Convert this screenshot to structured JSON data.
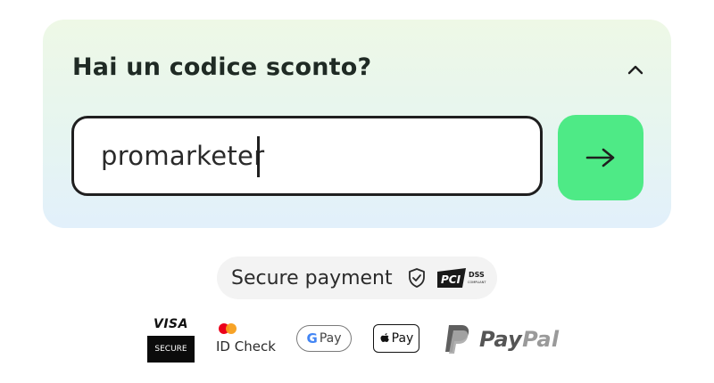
{
  "promo": {
    "title": "Hai un codice sconto?",
    "code_value": "promarketer",
    "toggle_icon": "chevron-up-icon",
    "apply_icon": "arrow-right-icon",
    "apply_color": "#4eea86"
  },
  "secure": {
    "label": "Secure payment",
    "shield_icon": "shield-check-icon",
    "pci_text": "PCI",
    "dss_text": "DSS",
    "compliant_text": "COMPLIANT"
  },
  "payment_methods": {
    "visa": {
      "word": "VISA",
      "secure": "SECURE"
    },
    "idcheck": {
      "label": "ID Check"
    },
    "gpay": {
      "g": "G",
      "pay": "Pay"
    },
    "applepay": {
      "pay": "Pay"
    },
    "paypal": {
      "pay": "Pay",
      "pal": "Pal"
    }
  }
}
